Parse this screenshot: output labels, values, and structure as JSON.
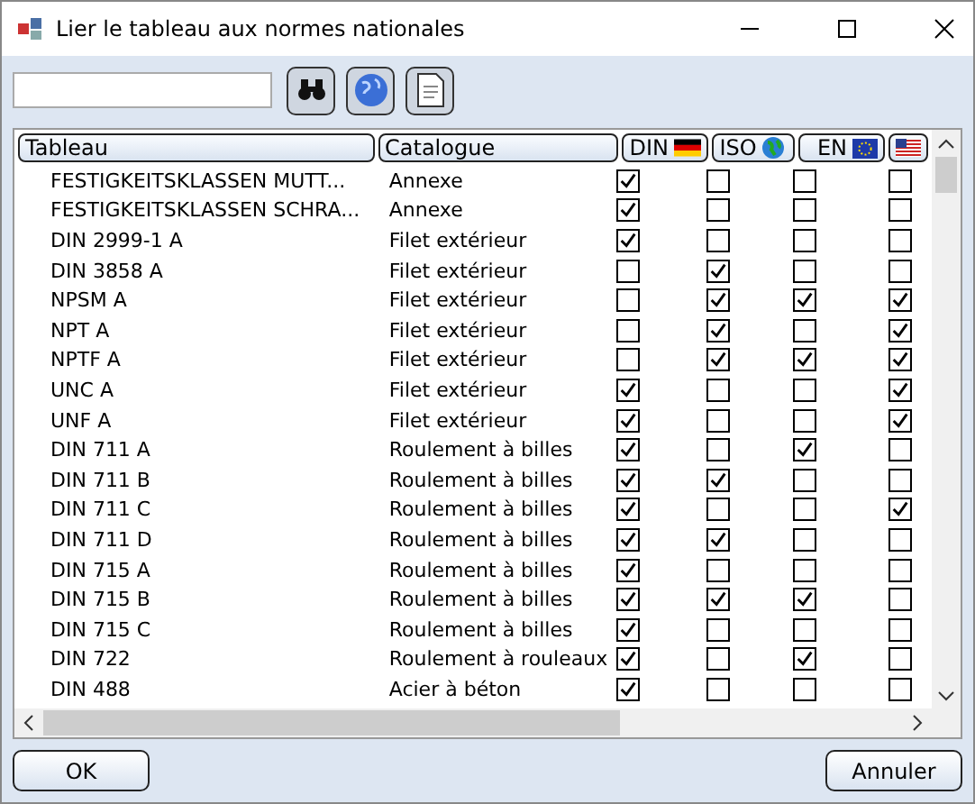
{
  "window": {
    "title": "Lier le tableau aux normes nationales"
  },
  "table": {
    "columns": [
      {
        "label": "Tableau",
        "kind": "text"
      },
      {
        "label": "Catalogue",
        "kind": "text"
      },
      {
        "label": "DIN",
        "kind": "din"
      },
      {
        "label": "ISO",
        "kind": "iso"
      },
      {
        "label": "EN",
        "kind": "en"
      },
      {
        "kind": "us"
      }
    ],
    "rows": [
      {
        "tableau": "FESTIGKEITSKLASSEN MUTT...",
        "catalogue": "Annexe",
        "checks": [
          true,
          false,
          false,
          false
        ]
      },
      {
        "tableau": "FESTIGKEITSKLASSEN SCHRA...",
        "catalogue": "Annexe",
        "checks": [
          true,
          false,
          false,
          false
        ]
      },
      {
        "tableau": "DIN 2999-1 A",
        "catalogue": "Filet extérieur",
        "checks": [
          true,
          false,
          false,
          false
        ]
      },
      {
        "tableau": "DIN 3858 A",
        "catalogue": "Filet extérieur",
        "checks": [
          false,
          true,
          false,
          false
        ]
      },
      {
        "tableau": "NPSM A",
        "catalogue": "Filet extérieur",
        "checks": [
          false,
          true,
          true,
          true
        ]
      },
      {
        "tableau": "NPT A",
        "catalogue": "Filet extérieur",
        "checks": [
          false,
          true,
          false,
          true
        ]
      },
      {
        "tableau": "NPTF A",
        "catalogue": "Filet extérieur",
        "checks": [
          false,
          true,
          true,
          true
        ]
      },
      {
        "tableau": "UNC A",
        "catalogue": "Filet extérieur",
        "checks": [
          true,
          false,
          false,
          true
        ]
      },
      {
        "tableau": "UNF A",
        "catalogue": "Filet extérieur",
        "checks": [
          true,
          false,
          false,
          true
        ]
      },
      {
        "tableau": "DIN 711 A",
        "catalogue": "Roulement à billes",
        "checks": [
          true,
          false,
          true,
          false
        ]
      },
      {
        "tableau": "DIN 711 B",
        "catalogue": "Roulement à billes",
        "checks": [
          true,
          true,
          false,
          false
        ]
      },
      {
        "tableau": "DIN 711 C",
        "catalogue": "Roulement à billes",
        "checks": [
          true,
          false,
          false,
          true
        ]
      },
      {
        "tableau": "DIN 711 D",
        "catalogue": "Roulement à billes",
        "checks": [
          true,
          true,
          false,
          false
        ]
      },
      {
        "tableau": "DIN 715 A",
        "catalogue": "Roulement à billes",
        "checks": [
          true,
          false,
          false,
          false
        ]
      },
      {
        "tableau": "DIN 715 B",
        "catalogue": "Roulement à billes",
        "checks": [
          true,
          true,
          true,
          false
        ]
      },
      {
        "tableau": "DIN 715 C",
        "catalogue": "Roulement à billes",
        "checks": [
          true,
          false,
          false,
          false
        ]
      },
      {
        "tableau": "DIN 722",
        "catalogue": "Roulement à rouleaux",
        "checks": [
          true,
          false,
          true,
          false
        ]
      },
      {
        "tableau": "DIN 488",
        "catalogue": "Acier à béton",
        "checks": [
          true,
          false,
          false,
          false
        ]
      }
    ]
  },
  "buttons": [
    "OK",
    "Annuler"
  ]
}
